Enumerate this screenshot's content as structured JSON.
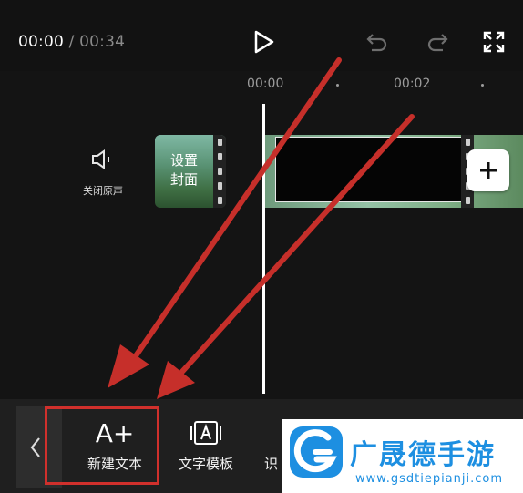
{
  "player": {
    "current_time": "00:00",
    "separator": " / ",
    "total_time": "00:34",
    "icons": {
      "play": "play-icon",
      "undo": "undo-icon",
      "redo": "redo-icon",
      "fullscreen": "fullscreen-icon"
    }
  },
  "timeline": {
    "ruler": [
      "00:00",
      "00:02"
    ],
    "mute_label": "关闭原声",
    "cover_label_line1": "设置",
    "cover_label_line2": "封面",
    "add_icon": "plus-icon"
  },
  "toolbar": {
    "back_icon": "chevron-left-icon",
    "new_text_label": "新建文本",
    "new_text_icon": "A+",
    "template_label": "文字模板",
    "recognize_label": "识"
  },
  "watermark": {
    "title": "广晟德手游",
    "url": "www.gsdtiepianji.com"
  },
  "colors": {
    "annotation_red": "#d0302c",
    "watermark_blue": "#1d8fe1"
  }
}
